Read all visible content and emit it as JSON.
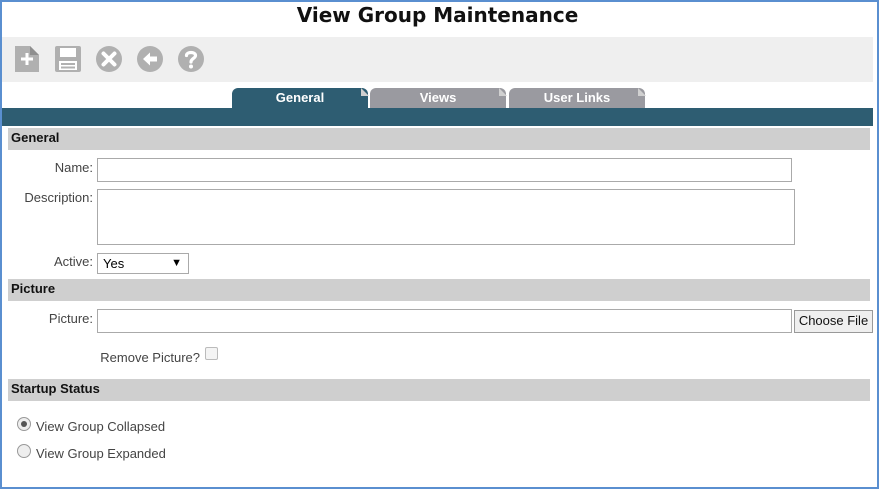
{
  "page": {
    "title": "View Group Maintenance"
  },
  "toolbar": {
    "buttons": [
      {
        "icon": "add-document-icon"
      },
      {
        "icon": "save-icon"
      },
      {
        "icon": "cancel-icon"
      },
      {
        "icon": "back-icon"
      },
      {
        "icon": "help-icon"
      }
    ]
  },
  "tabs": [
    {
      "label": "General",
      "active": true
    },
    {
      "label": "Views",
      "active": false
    },
    {
      "label": "User Links",
      "active": false
    }
  ],
  "general": {
    "heading": "General",
    "name_label": "Name:",
    "name_value": "",
    "description_label": "Description:",
    "description_value": "",
    "active_label": "Active:",
    "active_value": "Yes"
  },
  "picture": {
    "heading": "Picture",
    "picture_label": "Picture:",
    "picture_value": "",
    "choose_file_label": "Choose File",
    "remove_label": "Remove Picture?",
    "remove_checked": false
  },
  "startup": {
    "heading": "Startup Status",
    "options": [
      {
        "label": "View Group Collapsed",
        "checked": true
      },
      {
        "label": "View Group Expanded",
        "checked": false
      }
    ]
  },
  "colors": {
    "tab_active": "#2e5d72",
    "tab_inactive": "#9a9aa0",
    "section_bg": "#cfcfcf",
    "icon_gray": "#b0b0b0",
    "frame_border": "#5a8fd0"
  }
}
